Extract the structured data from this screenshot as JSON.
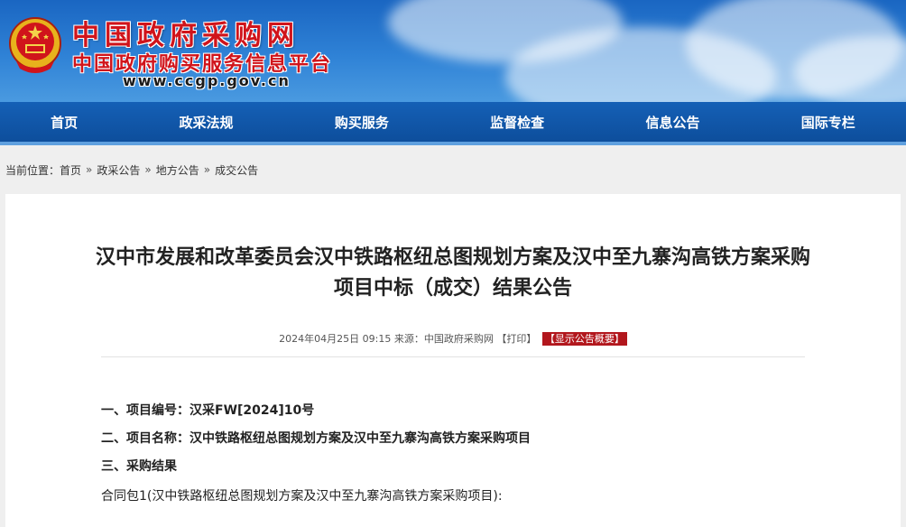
{
  "header": {
    "site_name": "中国政府采购网",
    "site_subtitle": "中国政府购买服务信息平台",
    "site_url": "www.ccgp.gov.cn"
  },
  "nav": [
    {
      "label": "首页"
    },
    {
      "label": "政采法规"
    },
    {
      "label": "购买服务"
    },
    {
      "label": "监督检查"
    },
    {
      "label": "信息公告"
    },
    {
      "label": "国际专栏"
    }
  ],
  "breadcrumb": {
    "prefix": "当前位置：",
    "items": [
      "首页",
      "政采公告",
      "地方公告",
      "成交公告"
    ],
    "separator": "»"
  },
  "article": {
    "title_line1": "汉中市发展和改革委员会汉中铁路枢纽总图规划方案及汉中至九寨沟高铁方案采购",
    "title_line2": "项目中标（成交）结果公告",
    "datetime": "2024年04月25日 09:15",
    "source": "来源：中国政府采购网",
    "print_label": "【打印】",
    "summary_label": "【显示公告概要】",
    "lines": [
      "一、项目编号：汉采FW[2024]10号",
      "二、项目名称：汉中铁路枢纽总图规划方案及汉中至九寨沟高铁方案采购项目",
      "三、采购结果",
      "合同包1(汉中铁路枢纽总图规划方案及汉中至九寨沟高铁方案采购项目):"
    ]
  },
  "colors": {
    "nav_bg": "#1560b6",
    "logo_red": "#d0141b",
    "tag_red": "#b2171d"
  }
}
